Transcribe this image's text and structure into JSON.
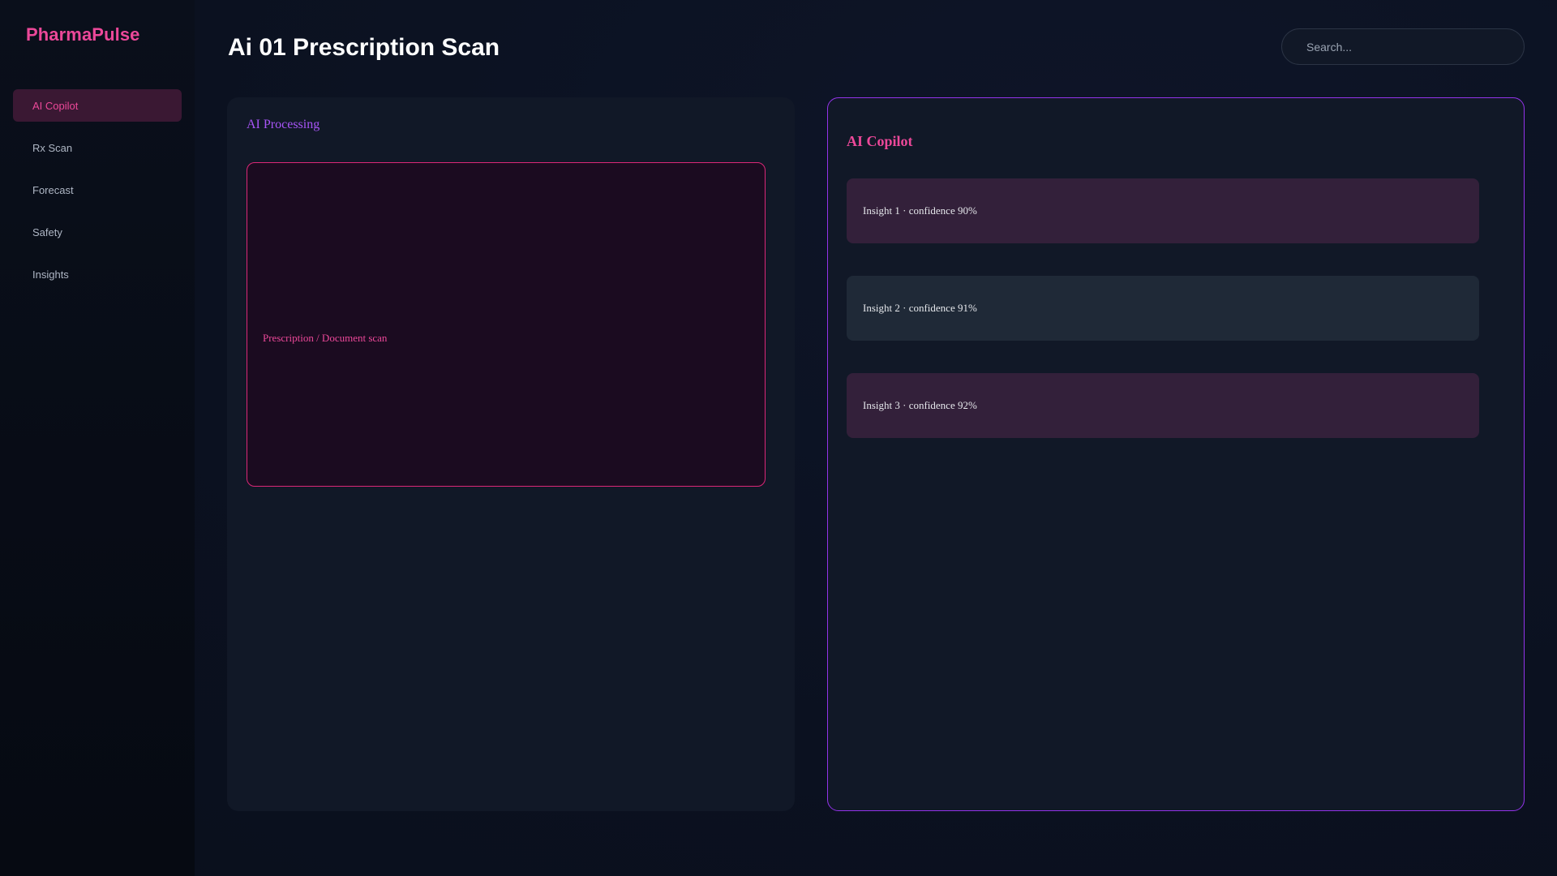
{
  "app": {
    "brand": "PharmaPulse",
    "page_title": "Ai 01 Prescription Scan",
    "accent_color": "#ec4899",
    "secondary_color": "#a855f7"
  },
  "sidebar": {
    "items": [
      {
        "label": "AI Copilot",
        "active": true
      },
      {
        "label": "Rx Scan",
        "active": false
      },
      {
        "label": "Forecast",
        "active": false
      },
      {
        "label": "Safety",
        "active": false
      },
      {
        "label": "Insights",
        "active": false
      }
    ]
  },
  "search": {
    "placeholder": "Search...",
    "value": ""
  },
  "processing_panel": {
    "title": "AI Processing",
    "scan_label": "Prescription / Document scan"
  },
  "copilot_panel": {
    "title": "AI Copilot",
    "insights": [
      {
        "text": "Insight 1 · confidence 90%",
        "confidence": 90
      },
      {
        "text": "Insight 2 · confidence 91%",
        "confidence": 91
      },
      {
        "text": "Insight 3 · confidence 92%",
        "confidence": 92
      }
    ]
  }
}
